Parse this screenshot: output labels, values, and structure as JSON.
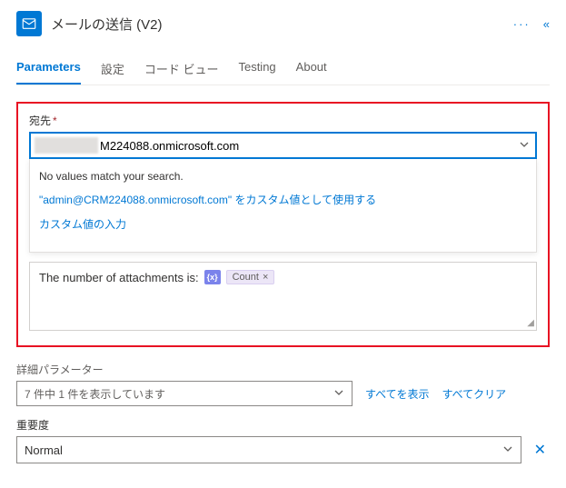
{
  "header": {
    "title": "メールの送信 (V2)"
  },
  "tabs": {
    "parameters": "Parameters",
    "settings": "設定",
    "codeview": "コード ビュー",
    "testing": "Testing",
    "about": "About"
  },
  "to": {
    "label": "宛先",
    "value": "M224088.onmicrosoft.com",
    "dropdown": {
      "no_match": "No values match your search.",
      "use_custom": "\"admin@CRM224088.onmicrosoft.com\" をカスタム値として使用する",
      "enter_custom": "カスタム値の入力"
    }
  },
  "body": {
    "text": "The number of attachments is:",
    "fx": "{x}",
    "token_label": "Count"
  },
  "advanced": {
    "label": "詳細パラメーター",
    "select_text": "7 件中 1 件を表示しています",
    "show_all": "すべてを表示",
    "clear_all": "すべてクリア"
  },
  "importance": {
    "label": "重要度",
    "value": "Normal"
  }
}
